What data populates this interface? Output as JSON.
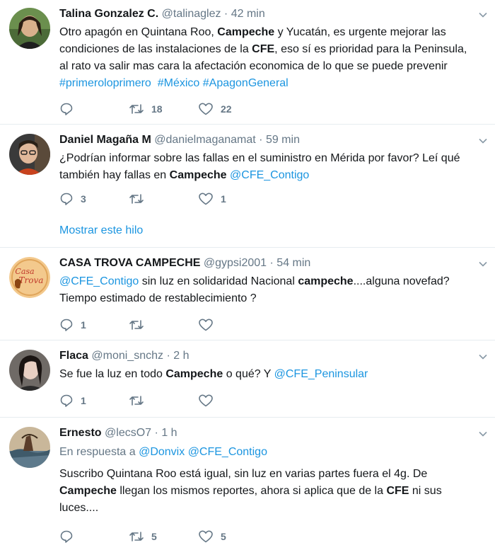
{
  "tweets": [
    {
      "name": "Talina Gonzalez C.",
      "handle": "@talinaglez",
      "dot": "·",
      "time": "42 min",
      "lines": [
        [
          {
            "t": "Otro apagón en Quintana Roo, "
          },
          {
            "t": "Campeche",
            "s": "bold"
          },
          {
            "t": " y Yucatán, es urgente mejorar las"
          }
        ],
        [
          {
            "t": "condiciones de las instalaciones de la "
          },
          {
            "t": "CFE",
            "s": "bold"
          },
          {
            "t": ", eso sí es prioridad para la Peninsula,"
          }
        ],
        [
          {
            "t": "al rato va salir mas cara la afectación economica de lo que se puede prevenir"
          }
        ],
        [
          {
            "t": "#primeroloprimero",
            "s": "link"
          },
          {
            "t": "  "
          },
          {
            "t": "#México",
            "s": "link"
          },
          {
            "t": " "
          },
          {
            "t": "#ApagonGeneral",
            "s": "link"
          }
        ]
      ],
      "replies": "",
      "retweets": "18",
      "likes": "22"
    },
    {
      "name": "Daniel Magaña M",
      "handle": "@danielmaganamat",
      "dot": "·",
      "time": "59 min",
      "lines": [
        [
          {
            "t": "¿Podrían informar sobre las fallas en el suministro en Mérida por favor? Leí qué"
          }
        ],
        [
          {
            "t": "también hay fallas en "
          },
          {
            "t": "Campeche",
            "s": "bold"
          },
          {
            "t": " "
          },
          {
            "t": "@CFE_Contigo",
            "s": "link"
          }
        ]
      ],
      "replies": "3",
      "retweets": "",
      "likes": "1",
      "show_thread": "Mostrar este hilo"
    },
    {
      "name": "CASA TROVA CAMPECHE",
      "handle": "@gypsi2001",
      "dot": "·",
      "time": "54 min",
      "lines": [
        [
          {
            "t": "@CFE_Contigo",
            "s": "link"
          },
          {
            "t": " sin luz en solidaridad Nacional "
          },
          {
            "t": "campeche",
            "s": "bold"
          },
          {
            "t": "....alguna novefad?"
          }
        ],
        [
          {
            "t": "Tiempo estimado de restablecimiento ?"
          }
        ]
      ],
      "replies": "1",
      "retweets": "",
      "likes": ""
    },
    {
      "name": "Flaca",
      "handle": "@moni_snchz",
      "dot": "·",
      "time": "2 h",
      "lines": [
        [
          {
            "t": "Se fue la luz en todo "
          },
          {
            "t": "Campeche",
            "s": "bold"
          },
          {
            "t": " o qué? Y "
          },
          {
            "t": "@CFE_Peninsular",
            "s": "link"
          }
        ]
      ],
      "replies": "1",
      "retweets": "",
      "likes": ""
    },
    {
      "name": "Ernesto",
      "handle": "@lecsO7",
      "dot": "·",
      "time": "1 h",
      "reply_prefix": "En respuesta a",
      "reply_users": [
        "@Donvix",
        "@CFE_Contigo"
      ],
      "lines": [
        [
          {
            "t": "Suscribo Quintana Roo está igual, sin luz en varias partes fuera el 4g. De"
          }
        ],
        [
          {
            "t": "Campeche",
            "s": "bold"
          },
          {
            "t": " llegan los mismos reportes, ahora si aplica que de la "
          },
          {
            "t": "CFE",
            "s": "bold"
          },
          {
            "t": " ni sus"
          }
        ],
        [
          {
            "t": "luces...."
          }
        ]
      ],
      "replies": "",
      "retweets": "5",
      "likes": "5"
    }
  ],
  "avatar_logo": {
    "line1": "Casa",
    "line2": "Trova"
  },
  "icons": {
    "reply": "reply-icon",
    "retweet": "retweet-icon",
    "like": "heart-icon",
    "caret": "chevron-down-icon"
  },
  "colors": {
    "link": "#1b95e0",
    "muted": "#657786",
    "border": "#e6ecf0",
    "text": "#14171a"
  }
}
